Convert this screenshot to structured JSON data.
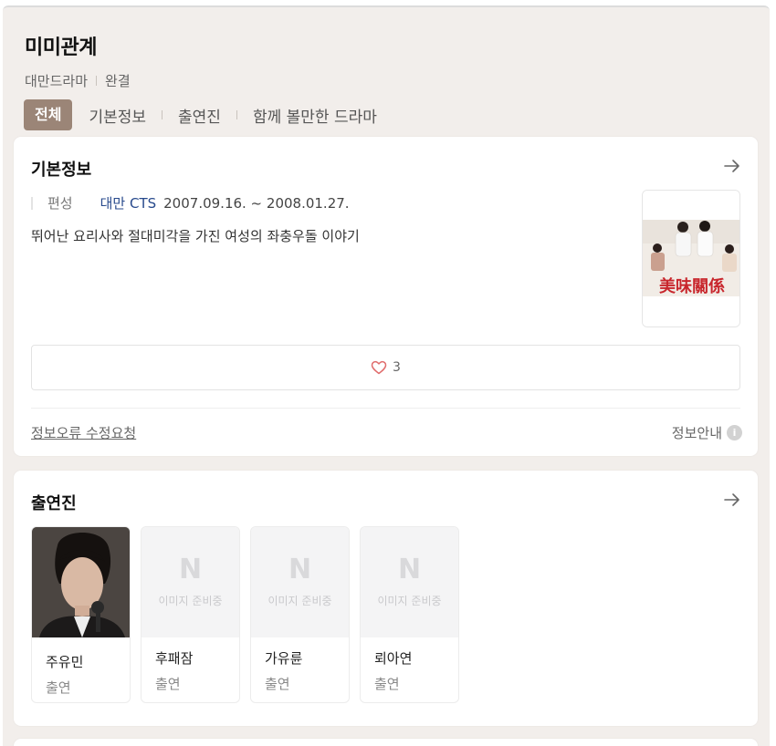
{
  "header": {
    "title": "미미관계",
    "genre": "대만드라마",
    "status": "완결",
    "tabs": [
      {
        "label": "전체",
        "active": true
      },
      {
        "label": "기본정보",
        "active": false
      },
      {
        "label": "출연진",
        "active": false
      },
      {
        "label": "함께 볼만한 드라마",
        "active": false
      }
    ]
  },
  "basic": {
    "title": "기본정보",
    "arrow_icon": "arrow-right-icon",
    "info_label": "편성",
    "channel": "대만 CTS",
    "dates": "2007.09.16. ~ 2008.01.27.",
    "description": "뛰어난 요리사와 절대미각을 가진 여성의 좌충우돌 이야기",
    "poster_text": "美味關係",
    "like_count": "3",
    "like_icon": "heart-icon",
    "report_link": "정보오류 수정요청",
    "guide_label": "정보안내",
    "guide_icon": "info-icon",
    "guide_icon_glyph": "i"
  },
  "cast": {
    "title": "출연진",
    "arrow_icon": "arrow-right-icon",
    "placeholder_logo": "N",
    "placeholder_text": "이미지 준비중",
    "members": [
      {
        "name": "주유민",
        "role": "출연",
        "has_photo": true
      },
      {
        "name": "후패잠",
        "role": "출연",
        "has_photo": false
      },
      {
        "name": "가유륜",
        "role": "출연",
        "has_photo": false
      },
      {
        "name": "뢰아연",
        "role": "출연",
        "has_photo": false
      }
    ]
  },
  "colors": {
    "accent": "#9b8577",
    "background": "#f2eeeb",
    "channel_link": "#27498c",
    "heart": "#e06c6c"
  }
}
